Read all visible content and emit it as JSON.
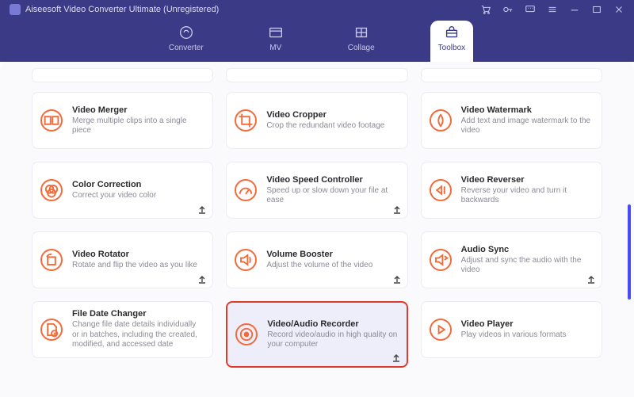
{
  "window": {
    "title": "Aiseesoft Video Converter Ultimate (Unregistered)"
  },
  "nav": {
    "items": [
      {
        "label": "Converter"
      },
      {
        "label": "MV"
      },
      {
        "label": "Collage"
      },
      {
        "label": "Toolbox"
      }
    ]
  },
  "cards": [
    {
      "title": "Video Merger",
      "desc": "Merge multiple clips into a single piece"
    },
    {
      "title": "Video Cropper",
      "desc": "Crop the redundant video footage"
    },
    {
      "title": "Video Watermark",
      "desc": "Add text and image watermark to the video"
    },
    {
      "title": "Color Correction",
      "desc": "Correct your video color"
    },
    {
      "title": "Video Speed Controller",
      "desc": "Speed up or slow down your file at ease"
    },
    {
      "title": "Video Reverser",
      "desc": "Reverse your video and turn it backwards"
    },
    {
      "title": "Video Rotator",
      "desc": "Rotate and flip the video as you like"
    },
    {
      "title": "Volume Booster",
      "desc": "Adjust the volume of the video"
    },
    {
      "title": "Audio Sync",
      "desc": "Adjust and sync the audio with the video"
    },
    {
      "title": "File Date Changer",
      "desc": "Change file date details individually or in batches, including the created, modified, and accessed date"
    },
    {
      "title": "Video/Audio Recorder",
      "desc": "Record video/audio in high quality on your computer"
    },
    {
      "title": "Video Player",
      "desc": "Play videos in various formats"
    }
  ]
}
